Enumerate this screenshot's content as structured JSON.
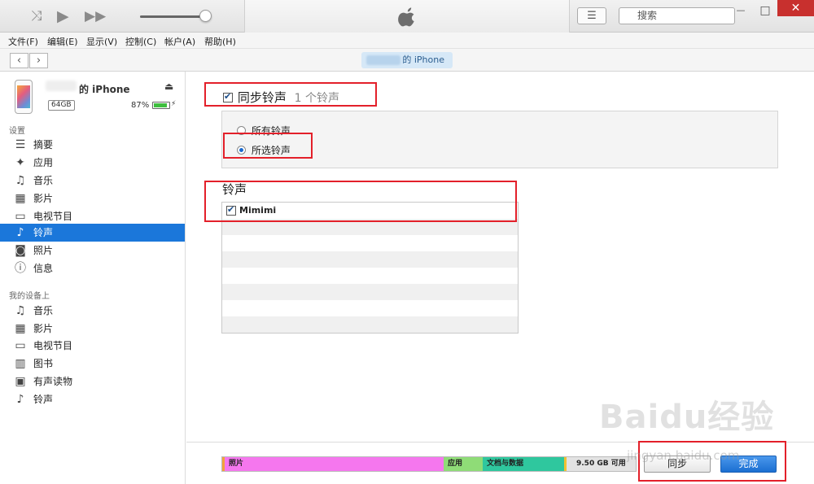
{
  "menu": [
    "文件(F)",
    "编辑(E)",
    "显示(V)",
    "控制(C)",
    "帐户(A)",
    "帮助(H)"
  ],
  "search": {
    "placeholder": "搜索"
  },
  "window": {
    "minimize": "—",
    "maximize": "□",
    "close": "✕"
  },
  "navbar": {
    "back": "‹",
    "forward": "›",
    "device_pill": "的 iPhone"
  },
  "device": {
    "name": "的 iPhone",
    "capacity": "64GB",
    "battery": "87%",
    "battery_level": 0.87
  },
  "sidebar": {
    "settings_label": "设置",
    "settings": [
      {
        "label": "摘要",
        "icon": "☰"
      },
      {
        "label": "应用",
        "icon": "✦"
      },
      {
        "label": "音乐",
        "icon": "♫"
      },
      {
        "label": "影片",
        "icon": "▦"
      },
      {
        "label": "电视节目",
        "icon": "▭"
      },
      {
        "label": "铃声",
        "icon": "♪"
      },
      {
        "label": "照片",
        "icon": "◙"
      },
      {
        "label": "信息",
        "icon": "ⓘ"
      }
    ],
    "ondevice_label": "我的设备上",
    "ondevice": [
      {
        "label": "音乐",
        "icon": "♫"
      },
      {
        "label": "影片",
        "icon": "▦"
      },
      {
        "label": "电视节目",
        "icon": "▭"
      },
      {
        "label": "图书",
        "icon": "▥"
      },
      {
        "label": "有声读物",
        "icon": "▣"
      },
      {
        "label": "铃声",
        "icon": "♪"
      }
    ]
  },
  "main": {
    "sync_label": "同步铃声",
    "sync_count": "1 个铃声",
    "opt_all": "所有铃声",
    "opt_selected": "所选铃声",
    "list_title": "铃声",
    "tones": [
      "Mimimi"
    ]
  },
  "storage": {
    "photos": "照片",
    "apps": "应用",
    "docs": "文档与数据",
    "free": "9.50 GB 可用",
    "colors": {
      "photos": "#f577ee",
      "apps": "#8fdc77",
      "docs": "#2fc79e",
      "free": "#e3e3e3"
    }
  },
  "buttons": {
    "sync": "同步",
    "done": "完成"
  },
  "watermark": {
    "brand": "Baidu经验",
    "url": "jingyan.baidu.com"
  }
}
